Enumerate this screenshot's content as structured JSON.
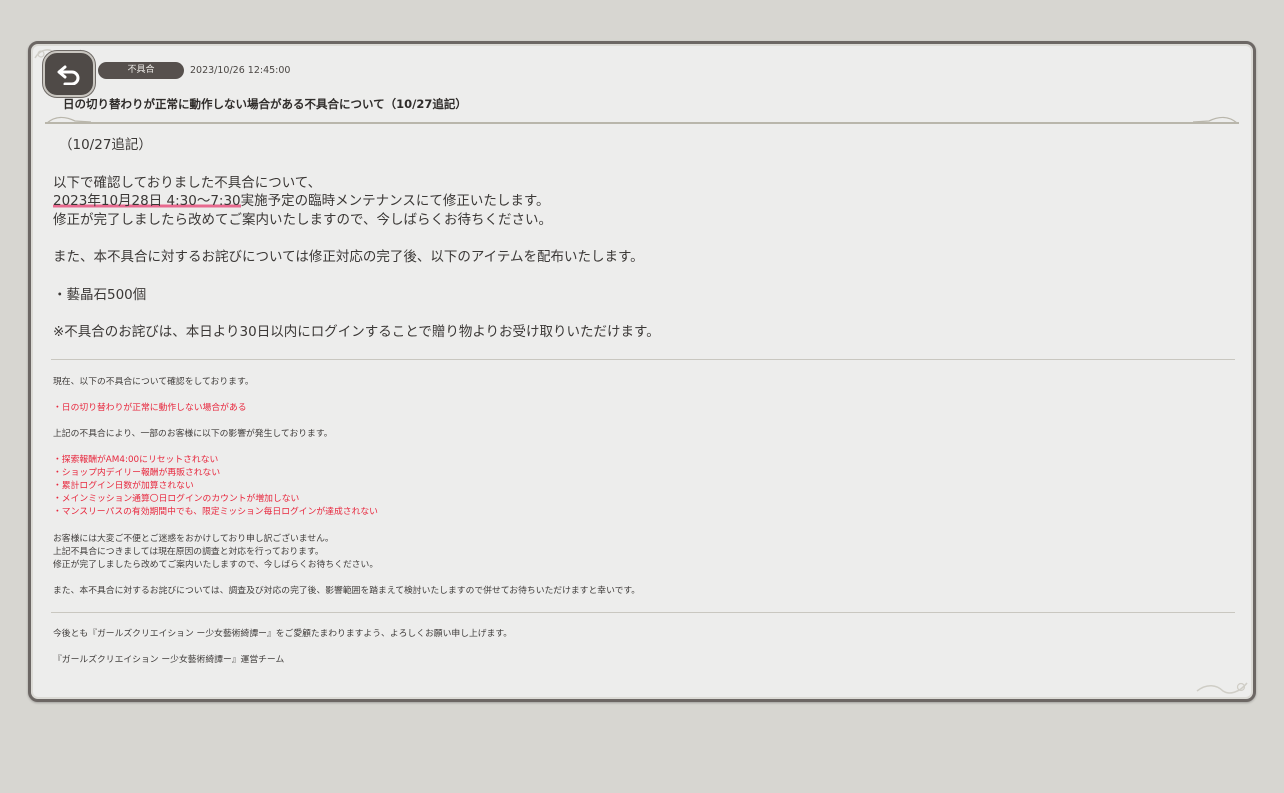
{
  "header": {
    "back_icon": "back-arrow-icon",
    "category": "不具合",
    "timestamp": "2023/10/26 12:45:00",
    "title": "日の切り替わりが正常に動作しない場合がある不具合について（10/27追記）"
  },
  "update_section": {
    "heading": "（10/27追記）",
    "line1": "以下で確認しておりました不具合について、",
    "line2_highlight": "2023年10月28日 4:30～7:30",
    "line2_rest": "実施予定の臨時メンテナンスにて修正いたします。",
    "line3": "修正が完了しましたら改めてご案内いたしますので、今しばらくお待ちください。",
    "line4": "また、本不具合に対するお詫びについては修正対応の完了後、以下のアイテムを配布いたします。",
    "item": "・藝晶石500個",
    "note": "※不具合のお詫びは、本日より30日以内にログインすることで贈り物よりお受け取りいただけます。"
  },
  "original_section": {
    "intro": "現在、以下の不具合について確認をしております。",
    "issue": "・日の切り替わりが正常に動作しない場合がある",
    "impact_intro": "上記の不具合により、一部のお客様に以下の影響が発生しております。",
    "impacts": [
      "・探索報酬がAM4:00にリセットされない",
      "・ショップ内デイリー報酬が再販されない",
      "・累計ログイン日数が加算されない",
      "・メインミッション通算〇日ログインのカウントが増加しない",
      "・マンスリーパスの有効期間中でも、限定ミッション毎日ログインが達成されない"
    ],
    "apology1": "お客様には大変ご不便とご迷惑をおかけしており申し訳ございません。",
    "apology2": "上記不具合につきましては現在原因の調査と対応を行っております。",
    "apology3": "修正が完了しましたら改めてご案内いたしますので、今しばらくお待ちください。",
    "apology4": "また、本不具合に対するお詫びについては、調査及び対応の完了後、影響範囲を踏まえて検討いたしますので併せてお待ちいただけますと幸いです。"
  },
  "footer": {
    "closing": "今後とも『ガールズクリエイション ー少女藝術綺譚ー』をご愛顧たまわりますよう、よろしくお願い申し上げます。",
    "signature": "『ガールズクリエイション ー少女藝術綺譚ー』運営チーム"
  },
  "colors": {
    "background": "#d7d6d1",
    "panel": "#ededec",
    "badge": "#56504d",
    "alert_red": "#e8283e",
    "highlight_pink": "#e86a8f"
  }
}
